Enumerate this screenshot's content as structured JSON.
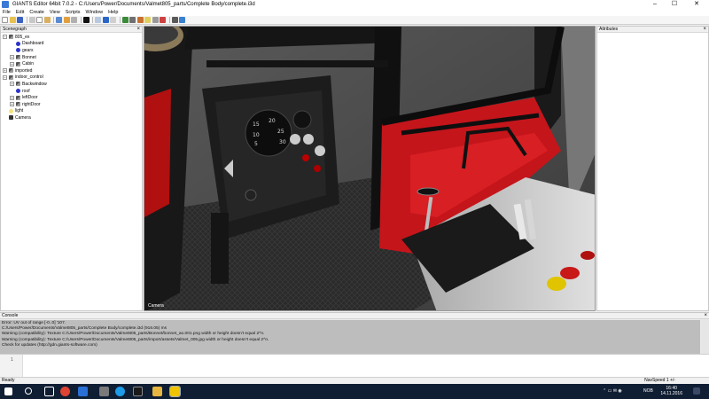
{
  "window": {
    "title": "GIANTS Editor 64bit 7.0.2 - C:/Users/Power/Documents/Valmet805_parts/Complete Body/complete.i3d",
    "controls": [
      "–",
      "☐",
      "✕"
    ]
  },
  "menu": [
    "File",
    "Edit",
    "Create",
    "View",
    "Scripts",
    "Window",
    "Help"
  ],
  "scenegraph": {
    "title": "Scenegraph",
    "nodes": [
      {
        "label": "805_ex",
        "exp": "−",
        "icon": "group"
      },
      {
        "label": "Dashboard",
        "exp": "",
        "icon": "mesh"
      },
      {
        "label": "gears",
        "exp": "",
        "icon": "mesh"
      },
      {
        "label": "Bonnet",
        "exp": "+",
        "icon": "group"
      },
      {
        "label": "Cabin",
        "exp": "+",
        "icon": "group"
      },
      {
        "label": "imported",
        "exp": "+",
        "icon": "group"
      },
      {
        "label": "indoor_control",
        "exp": "−",
        "icon": "group"
      },
      {
        "label": "Backwindow",
        "exp": "+",
        "icon": "group"
      },
      {
        "label": "roof",
        "exp": "",
        "icon": "mesh"
      },
      {
        "label": "leftDoor",
        "exp": "+",
        "icon": "group"
      },
      {
        "label": "rightDoor",
        "exp": "+",
        "icon": "group"
      },
      {
        "label": "light",
        "exp": "",
        "icon": "light"
      },
      {
        "label": "Camera",
        "exp": "",
        "icon": "cam"
      }
    ]
  },
  "attributes": {
    "title": "Attributes"
  },
  "viewport": {
    "camera_label": "Camera"
  },
  "console": {
    "title": "Console",
    "lines": [
      "Error: UV out of range [-0..0] '107.",
      "C:/Users/Power/Documents/Valmet805_parts/Complete Body/complete.i3d (916.05) ms",
      "Warning (compatibility): Texture C:/Users/Power/Documents/Valmet805_parts/Bonnet/bonnet_ao.001.png width or height doesn't equal 2^n.",
      "Warning (compatibility): Texture C:/Users/Power/Documents/Valmet805_parts/import/assets/Valmet_005.jpg width or height doesn't equal 2^n.",
      "Check for updates (http://gdn.giants-software.com)"
    ],
    "input_line_no": "1"
  },
  "status": {
    "left": "Ready",
    "right": "NavSpeed 1 +/-"
  },
  "taskbar": {
    "time": "16:40",
    "date": "14.11.2016",
    "lang": "NOB"
  }
}
